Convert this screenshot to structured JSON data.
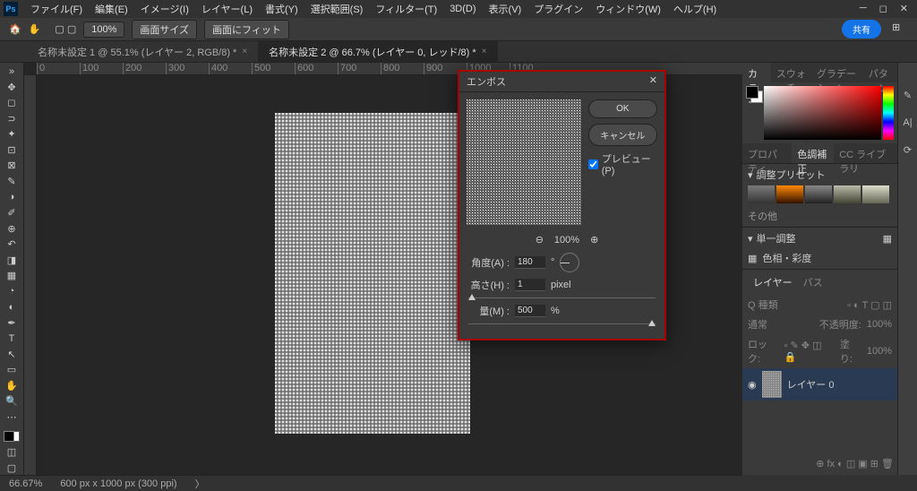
{
  "menubar": {
    "items": [
      "ファイル(F)",
      "編集(E)",
      "イメージ(I)",
      "レイヤー(L)",
      "書式(Y)",
      "選択範囲(S)",
      "フィルター(T)",
      "3D(D)",
      "表示(V)",
      "プラグイン",
      "ウィンドウ(W)",
      "ヘルプ(H)"
    ]
  },
  "options": {
    "zoom": "100%",
    "btn1": "画面サイズ",
    "btn2": "画面にフィット",
    "share": "共有"
  },
  "tabs": [
    {
      "label": "名称未設定 1 @ 55.1% (レイヤー 2, RGB/8) *"
    },
    {
      "label": "名称未設定 2 @ 66.7% (レイヤー 0, レッド/8) *"
    }
  ],
  "ruler_ticks": [
    "0",
    "100",
    "200",
    "300",
    "400",
    "500",
    "600",
    "700",
    "800",
    "900",
    "1000",
    "1100"
  ],
  "panels": {
    "color_tabs": [
      "カラー",
      "スウォッチ",
      "グラデーション",
      "パターン"
    ],
    "prop_tabs": [
      "プロパティ",
      "色調補正",
      "CC ライブラリ"
    ],
    "adj_header": "調整プリセット",
    "others": "その他",
    "single_adj": "単一調整",
    "hue_sat": "色相・彩度",
    "layers_tabs": [
      "レイヤー",
      "パス"
    ],
    "blend": "通常",
    "opacity_label": "不透明度:",
    "opacity": "100%",
    "lock_label": "ロック:",
    "fill_label": "塗り:",
    "fill": "100%",
    "layer0": "レイヤー 0"
  },
  "dialog": {
    "title": "エンボス",
    "ok": "OK",
    "cancel": "キャンセル",
    "preview": "プレビュー(P)",
    "zoom": "100%",
    "angle_label": "角度(A) :",
    "angle": "180",
    "angle_unit": "°",
    "height_label": "高さ(H) :",
    "height": "1",
    "height_unit": "pixel",
    "amount_label": "量(M) :",
    "amount": "500",
    "amount_unit": "%"
  },
  "status": {
    "zoom": "66.67%",
    "info": "600 px x 1000 px (300 ppi)"
  }
}
